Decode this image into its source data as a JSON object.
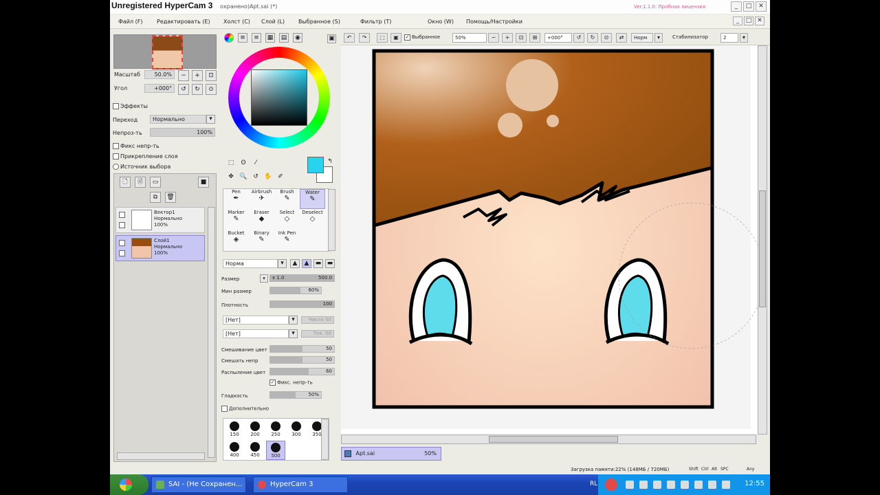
{
  "window": {
    "title": "Unregistered HyperCam 3",
    "doc_title": "охранено)Apt.sai (*)",
    "version": "Ver.1.1.0: Пробная лицензия",
    "min": "_",
    "max": "□",
    "close": "✕"
  },
  "menu": [
    "Файл (F)",
    "Редактировать (E)",
    "Холст (C)",
    "Слой (L)",
    "Выбранное (S)",
    "Фильтр (T)",
    "Окно (W)",
    "Помощь/Настройки"
  ],
  "menu_right": [
    "_",
    "□",
    "✕"
  ],
  "navigator": {
    "zoom_label": "Масштаб",
    "zoom_value": "50.0%",
    "angle_label": "Угол",
    "angle_value": "+000°"
  },
  "layer_props": {
    "effects": "Эффекты",
    "mode_label": "Переход",
    "mode_value": "Нормально",
    "opacity_label": "Непроз-ть",
    "opacity_value": "100%",
    "opts": [
      "Фикс непр-ть",
      "Прикрепление слоя",
      "Источник выбора"
    ]
  },
  "layers": [
    {
      "name": "Вектор1",
      "mode": "Нормально",
      "opacity": "100%",
      "selected": false
    },
    {
      "name": "Слой1",
      "mode": "Нормально",
      "opacity": "100%",
      "selected": true
    }
  ],
  "tools": [
    {
      "label": "Pen",
      "icon": "pen-icon",
      "glyph": "✒"
    },
    {
      "label": "Airbrush",
      "icon": "airbrush-icon",
      "glyph": "✈"
    },
    {
      "label": "Brush",
      "icon": "brush-icon",
      "glyph": "✎"
    },
    {
      "label": "Water",
      "icon": "water-icon",
      "glyph": "✎"
    },
    {
      "label": "Marker",
      "icon": "marker-icon",
      "glyph": "✎"
    },
    {
      "label": "Eraser",
      "icon": "eraser-icon",
      "glyph": "◆"
    },
    {
      "label": "Select",
      "icon": "select-icon",
      "glyph": "◇"
    },
    {
      "label": "Deselect",
      "icon": "deselect-icon",
      "glyph": "◇"
    },
    {
      "label": "Bucket",
      "icon": "bucket-icon",
      "glyph": "◈"
    },
    {
      "label": "Binary",
      "icon": "binary-icon",
      "glyph": "✎"
    },
    {
      "label": "Ink Pen",
      "icon": "ink-pen-icon",
      "glyph": "✎"
    }
  ],
  "brush": {
    "mode": "Норма",
    "size_label": "Размер",
    "size_mult": "x 1.0",
    "size_value": "500.0",
    "min_size_label": "Мин размер",
    "min_size_value": "60%",
    "min_size_frac": 0.6,
    "density_label": "Плотность",
    "density_value": "100",
    "density_frac": 1.0,
    "tex1": "[Нет]",
    "tex1_extra": "Число 50",
    "tex2": "[Нет]",
    "tex2_extra": "Тек. 50",
    "blend_label": "Смешивание цвет",
    "blend_value": "50",
    "blend_frac": 0.5,
    "dilution_label": "Смешать непр",
    "dilution_value": "50",
    "dilution_frac": 0.5,
    "persist_label": "Распыление цвет",
    "persist_value": "60",
    "persist_frac": 0.6,
    "keep_opacity": "Фикс. непр-ть",
    "hardness_label": "Гладкость",
    "hardness_value": "50%",
    "hardness_frac": 0.5,
    "advanced": "Дополнительно",
    "sizes": [
      "150",
      "200",
      "250",
      "300",
      "350",
      "400",
      "450",
      "500"
    ]
  },
  "canvas_toolbar": {
    "selection_label": "Выбранное",
    "zoom": "50%",
    "angle": "+000°",
    "mode": "Норм",
    "stabilizer_label": "Стабилизатор",
    "stabilizer_value": "2"
  },
  "document_tab": {
    "name": "Apt.sai",
    "zoom": "50%"
  },
  "status": {
    "memory": "Загрузка памяти:22% (148МБ / 720МБ)",
    "keys": [
      "Shift",
      "Ctrl",
      "Alt",
      "SPC",
      "Any"
    ]
  },
  "taskbar": {
    "tasks": [
      {
        "label": "SAI - (Не Сохранен..."
      },
      {
        "label": "HyperCam 3"
      }
    ],
    "lang": "RL",
    "clock": "12:55"
  },
  "colors": {
    "fg": "#28d3f0",
    "bg": "#ffffff",
    "hair": "#a5550d",
    "skin": "#f4c7ad",
    "eye": "#5fdcec",
    "accent_select": "#c8c6f2"
  }
}
